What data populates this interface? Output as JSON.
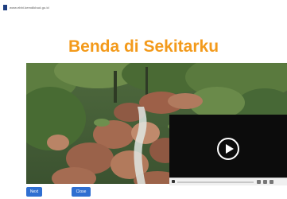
{
  "header": {
    "brand": "www.ebbi.kemdikbud.go.id"
  },
  "page": {
    "title": "Benda di Sekitarku"
  },
  "buttons": {
    "next": "Next",
    "close": "Close"
  },
  "colors": {
    "title": "#f39a1b",
    "button": "#2f6fd1",
    "video_bg": "#0c0c0c"
  },
  "icons": [
    "logo-icon",
    "play-icon"
  ]
}
